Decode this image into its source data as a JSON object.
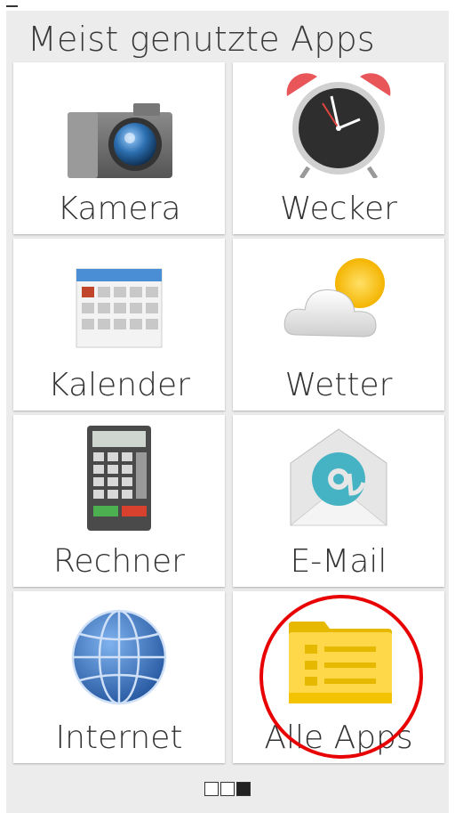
{
  "header": {
    "title": "Meist genutzte Apps"
  },
  "apps": [
    {
      "label": "Kamera",
      "icon": "camera-icon"
    },
    {
      "label": "Wecker",
      "icon": "alarm-clock-icon"
    },
    {
      "label": "Kalender",
      "icon": "calendar-icon"
    },
    {
      "label": "Wetter",
      "icon": "weather-icon"
    },
    {
      "label": "Rechner",
      "icon": "calculator-icon"
    },
    {
      "label": "E-Mail",
      "icon": "email-icon"
    },
    {
      "label": "Internet",
      "icon": "globe-icon"
    },
    {
      "label": "Alle Apps",
      "icon": "folder-list-icon"
    }
  ],
  "pager": {
    "pages": 3,
    "active_index": 2
  },
  "colors": {
    "highlight": "#e80000",
    "background": "#ececec"
  }
}
